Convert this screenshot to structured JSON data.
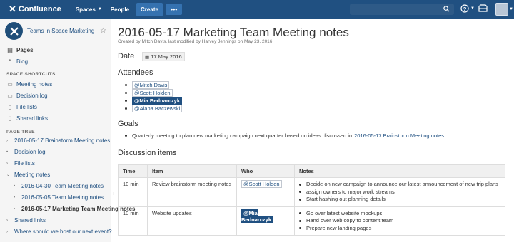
{
  "topbar": {
    "brand": "Confluence",
    "nav_spaces": "Spaces",
    "nav_people": "People",
    "create_label": "Create",
    "more_label": "•••",
    "help_icon": "help-icon",
    "notifications_icon": "bell-icon",
    "colors": {
      "bar": "#205081",
      "button": "#3572b0"
    }
  },
  "sidebar": {
    "space_name": "Teams in Space Marketing",
    "pages_label": "Pages",
    "blog_label": "Blog",
    "shortcuts_heading": "SPACE SHORTCUTS",
    "shortcuts": [
      {
        "label": "Meeting notes",
        "icon": "meeting-notes-icon"
      },
      {
        "label": "Decision log",
        "icon": "decision-log-icon"
      },
      {
        "label": "File lists",
        "icon": "file-list-icon"
      },
      {
        "label": "Shared links",
        "icon": "shared-links-icon"
      }
    ],
    "tree_heading": "PAGE TREE",
    "tree": [
      {
        "label": "2016-05-17 Brainstorm Meeting notes"
      },
      {
        "label": "Decision log"
      },
      {
        "label": "File lists"
      },
      {
        "label": "Meeting notes"
      },
      {
        "label": "2016-04-30 Team Meeting notes"
      },
      {
        "label": "2016-05-05 Team Meeting notes"
      },
      {
        "label": "2016-05-17 Marketing Team Meeting notes"
      },
      {
        "label": "Shared links"
      },
      {
        "label": "Where should we host our next event?"
      }
    ]
  },
  "page": {
    "title": "2016-05-17 Marketing Team Meeting notes",
    "byline": "Created by Mitch Davis, last modified by Harvey Jennings on May 23, 2016",
    "date_heading": "Date",
    "date_value": "17 May 2016",
    "attendees_heading": "Attendees",
    "attendees": [
      "Mitch Davis",
      "Scott Holden",
      "Mia Bednarczyk",
      "Alana Baczewski"
    ],
    "goals_heading": "Goals",
    "goal_text": "Quarterly meeting to plan new marketing campaign next quarter based on ideas discussed in",
    "goal_link": "2016-05-17 Brainstorm Meeting notes",
    "discussion_heading": "Discussion items",
    "table": {
      "headers": [
        "Time",
        "Item",
        "Who",
        "Notes"
      ],
      "rows": [
        {
          "time": "10 min",
          "item": "Review brainstorm meeting notes",
          "who": "Scott Holden",
          "notes": [
            "Decide on new campaign to announce our latest announcement of new trip plans",
            "assign owners to major work streams",
            "Start hashing out planning details"
          ]
        },
        {
          "time": "10 min",
          "item": "Website updates",
          "who": "Mia Bednarczyk",
          "notes": [
            "Go over latest website mockups",
            "Hand over web copy to content team",
            "Prepare new landing pages"
          ]
        }
      ]
    }
  }
}
